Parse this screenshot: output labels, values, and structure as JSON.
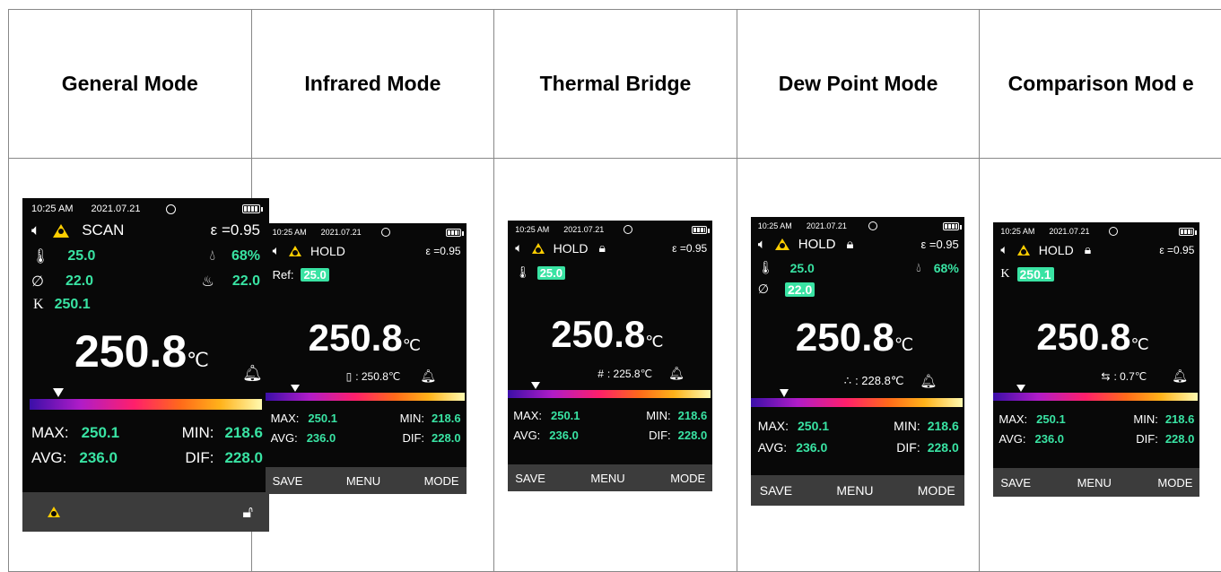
{
  "headers": [
    "General Mode",
    "Infrared Mode",
    "Thermal Bridge",
    "Dew Point Mode",
    "Comparison Mod e"
  ],
  "common": {
    "time": "10:25 AM",
    "date": "2021.07.21",
    "emissivity": "ε =0.95",
    "main_value": "250.8",
    "unit": "℃",
    "max_label": "MAX:",
    "max_value": "250.1",
    "min_label": "MIN:",
    "min_value": "218.6",
    "avg_label": "AVG:",
    "avg_value": "236.0",
    "dif_label": "DIF:",
    "dif_value": "228.0",
    "save": "SAVE",
    "menu": "MENU",
    "mode": "MODE"
  },
  "general": {
    "status": "SCAN",
    "temp": "25.0",
    "humidity": "68%",
    "dew": "22.0",
    "wet_bulb": "22.0",
    "k_label": "K",
    "k_value": "250.1"
  },
  "infrared": {
    "status": "HOLD",
    "ref_label": "Ref:",
    "ref_value": "25.0",
    "sub_value": ": 250.8℃"
  },
  "thermal": {
    "status": "HOLD",
    "temp_value": "25.0",
    "sub_value": ": 225.8℃"
  },
  "dew": {
    "status": "HOLD",
    "temp": "25.0",
    "humidity": "68%",
    "dew_value": "22.0",
    "sub_value": ": 228.8℃"
  },
  "comparison": {
    "status": "HOLD",
    "k_label": "K",
    "k_value": "250.1",
    "sub_value": ": 0.7℃"
  },
  "colors": {
    "accent": "#39e3a3",
    "warning": "#ffce00",
    "screen_bg": "#080808",
    "softkey_bg": "#3c3c3c"
  }
}
